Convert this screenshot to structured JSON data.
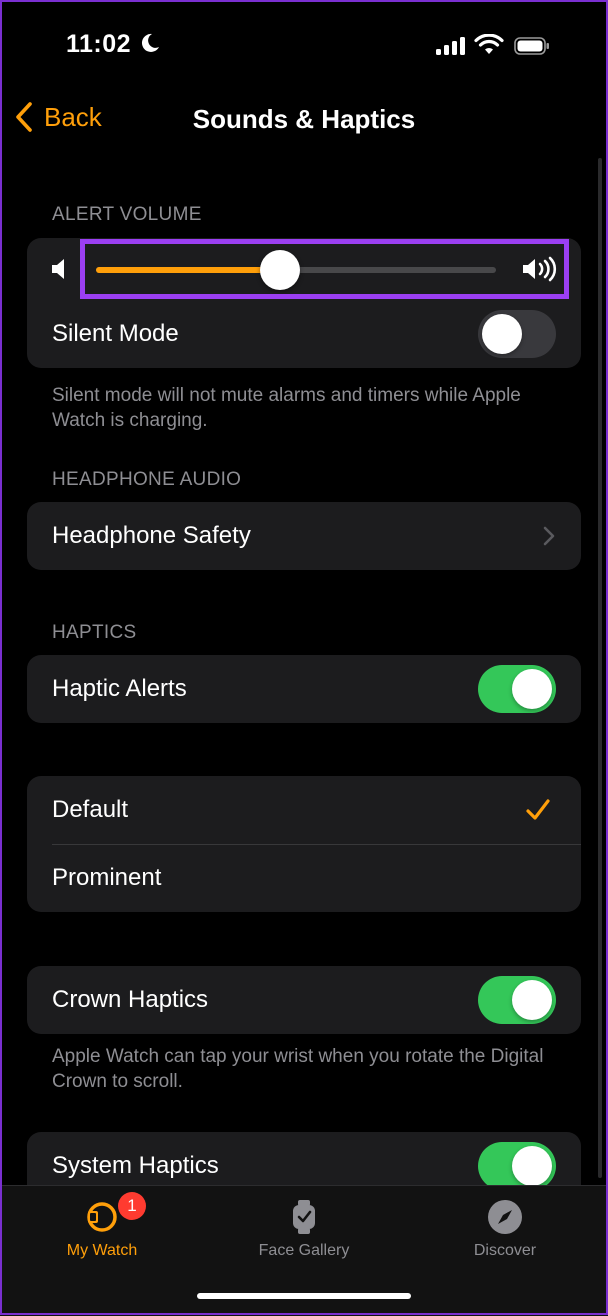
{
  "status_bar": {
    "time": "11:02"
  },
  "nav": {
    "back_label": "Back",
    "title": "Sounds & Haptics"
  },
  "alert_volume": {
    "header": "ALERT VOLUME",
    "level": 0.46,
    "silent_mode_label": "Silent Mode",
    "silent_mode_on": false,
    "footer": "Silent mode will not mute alarms and timers while Apple Watch is charging."
  },
  "headphone_audio": {
    "header": "HEADPHONE AUDIO",
    "safety_label": "Headphone Safety"
  },
  "haptics": {
    "header": "HAPTICS",
    "alerts_label": "Haptic Alerts",
    "alerts_on": true,
    "options": [
      {
        "label": "Default",
        "selected": true
      },
      {
        "label": "Prominent",
        "selected": false
      }
    ],
    "crown_label": "Crown Haptics",
    "crown_on": true,
    "crown_footer": "Apple Watch can tap your wrist when you rotate the Digital Crown to scroll.",
    "system_label": "System Haptics",
    "system_on": true
  },
  "tab_bar": {
    "tabs": [
      {
        "label": "My Watch",
        "icon": "watch-icon",
        "active": true,
        "badge": "1"
      },
      {
        "label": "Face Gallery",
        "icon": "watch-face-icon",
        "active": false
      },
      {
        "label": "Discover",
        "icon": "compass-icon",
        "active": false
      }
    ]
  },
  "colors": {
    "accent": "#ff9f0a",
    "toggle_on": "#34c759",
    "highlight": "#9b3ff2",
    "badge": "#ff3b30"
  }
}
